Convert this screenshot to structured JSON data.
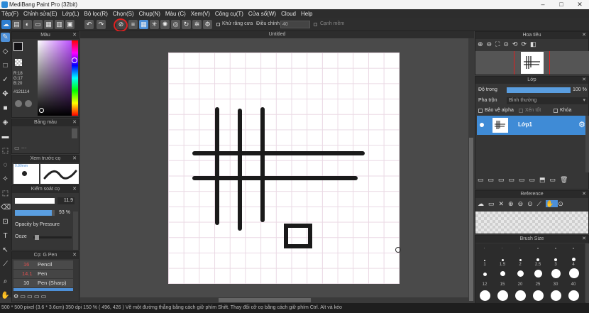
{
  "window": {
    "title": "MediBang Paint Pro (32bit)",
    "controls": [
      "–",
      "□",
      "✕"
    ]
  },
  "menu": [
    "Tệp(F)",
    "Chỉnh sửa(E)",
    "Lớp(L)",
    "Bộ lọc(R)",
    "Chọn(S)",
    "Chụp(N)",
    "Màu (C)",
    "Xem(V)",
    "Công cụ(T)",
    "Cửa sổ(W)",
    "Cloud",
    "Help"
  ],
  "toolbar": {
    "antialias": "Khử răng cưa",
    "adjust": "Điều chỉnh",
    "adjust_value": "40",
    "edge": "Cạnh mềm"
  },
  "color_panel": {
    "title": "Màu",
    "r": "R:18",
    "g": "G:17",
    "b": "B:20",
    "hex": "#121114"
  },
  "palette_panel": {
    "title": "Bảng màu"
  },
  "preview_panel": {
    "title": "Xem trước cọ",
    "size": "0.80mm"
  },
  "brush_control": {
    "title": "Kiểm soát cọ",
    "size": "11.9",
    "opacity": "93 %",
    "opacity_pressure": "Opacity by Pressure",
    "ooze": "Ooze"
  },
  "brush_list": {
    "title": "Cọ: G Pen",
    "items": [
      {
        "size": "16",
        "name": "Pencil"
      },
      {
        "size": "14.1",
        "name": "Pen"
      },
      {
        "size": "10",
        "name": "Pen (Sharp)"
      }
    ]
  },
  "document": {
    "tab": "Untitled"
  },
  "navigator": {
    "title": "Hoa tiêu"
  },
  "layer_panel": {
    "title": "Lớp",
    "opacity_label": "Độ trong",
    "opacity_value": "100 %",
    "blend_label": "Pha trộn",
    "blend_value": "Bình thường",
    "protect_alpha": "Bảo vệ alpha",
    "clipping": "Xén tốt",
    "lock": "Khóa",
    "layer_name": "Lớp1"
  },
  "reference_panel": {
    "title": "Reference"
  },
  "brush_size_panel": {
    "title": "Brush Size",
    "labels_row1": [
      "1",
      "1.5",
      "2",
      "2.5",
      "3",
      "4"
    ],
    "labels_row2": [
      "12",
      "15",
      "20",
      "25",
      "30",
      "40"
    ]
  },
  "status": "500 * 500 pixel   (3.6 * 3.6cm)  350 dpi   150 %   ( 496, 426 )   Vẽ một đường thẳng bằng cách giữ phím Shift. Thay đổi cỡ cọ bằng cách giữ phím Ctrl. Alt và kéo",
  "colors": {
    "accent": "#4d90d8",
    "annotation": "#e02020",
    "fg_color": "#121114"
  }
}
